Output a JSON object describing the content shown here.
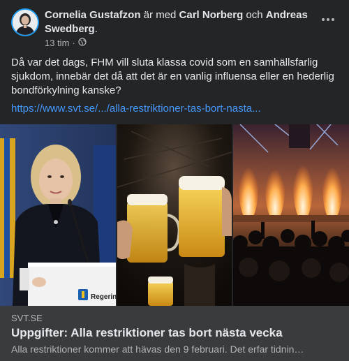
{
  "post": {
    "author": "Cornelia Gustafzon",
    "with_text": "är med",
    "tagged_1": "Carl Norberg",
    "and_text": "och",
    "tagged_2": "Andreas Swedberg",
    "period": ".",
    "time": "13 tim",
    "separator": "·",
    "privacy_icon": "globe-icon",
    "more_icon": "more-options-icon",
    "text": "Då var det dags, FHM vill sluta klassa covid som en samhällsfarlig sjukdom, innebär det då att det är en vanlig influensa eller en hederlig bondförkylning kanske?",
    "url": "https://www.svt.se/.../alla-restriktioner-tas-bort-nasta..."
  },
  "images": {
    "podium_label": "Regerin"
  },
  "link_preview": {
    "domain": "SVT.SE",
    "headline": "Uppgifter: Alla restriktioner tas bort nästa vecka",
    "description": "Alla restriktioner kommer att hävas den 9 februari. Det erfar tidnin…"
  },
  "colors": {
    "card_bg": "#242526",
    "link_preview_bg": "#3a3b3c",
    "link_blue": "#4599ff",
    "avatar_ring": "#1d9bf0"
  }
}
